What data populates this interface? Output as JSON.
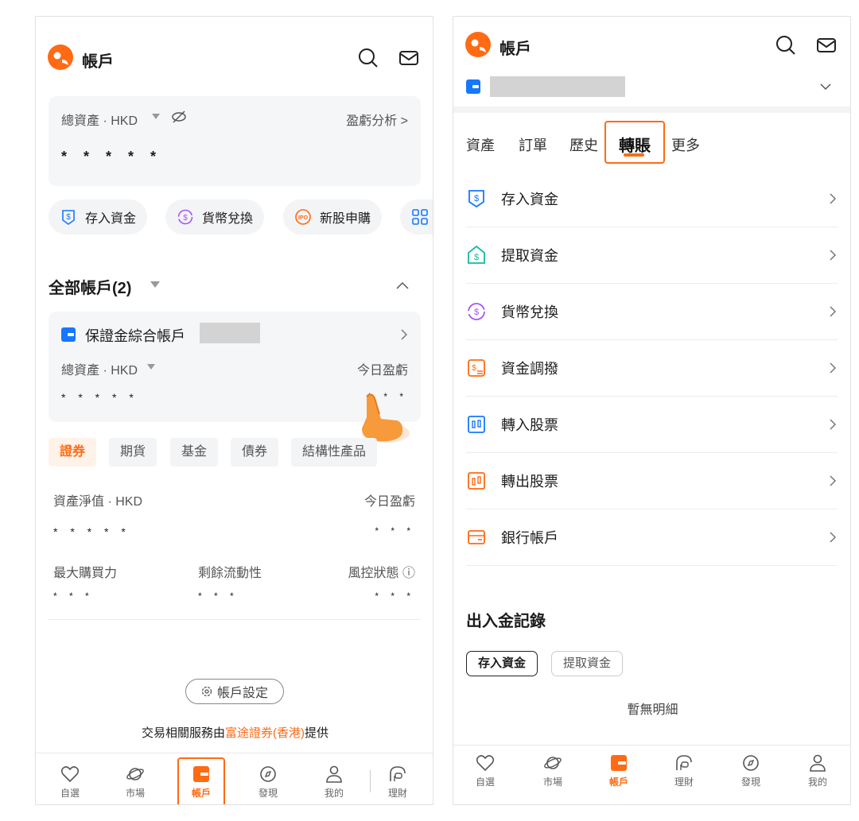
{
  "colors": {
    "accent": "#ff6a13",
    "blue": "#1677ff",
    "teal": "#14b8a6"
  },
  "left": {
    "header": {
      "title": "帳戶"
    },
    "asset_card": {
      "label": "總資產 · HKD",
      "analysis_link": "盈虧分析 >",
      "masked_value": "* * * * *"
    },
    "quick_actions": [
      {
        "label": "存入資金",
        "icon": "deposit-icon"
      },
      {
        "label": "貨幣兌換",
        "icon": "exchange-icon"
      },
      {
        "label": "新股申購",
        "icon": "ipo-icon"
      }
    ],
    "accounts_section": {
      "title": "全部帳戶(2)"
    },
    "account_card": {
      "name": "保證金綜合帳戶",
      "asset_label": "總資產 · HKD",
      "pl_label": "今日盈虧",
      "masked_value": "* * * * *",
      "masked_pl": "* * *"
    },
    "product_tabs": [
      "證券",
      "期貨",
      "基金",
      "債券",
      "結構性產品"
    ],
    "details": {
      "net_label": "資產淨值 · HKD",
      "pl_label": "今日盈虧",
      "masked_net": "* * * * *",
      "masked_pl": "* * *",
      "buying_power": "最大購買力",
      "liquidity": "剩餘流動性",
      "risk_status": "風控狀態 ⓘ",
      "masked_small": "* * *"
    },
    "settings_button": "帳戶設定",
    "footer": {
      "prefix": "交易相關服務由",
      "provider": "富途證券(香港)",
      "suffix": "提供"
    },
    "nav": [
      "自選",
      "市場",
      "帳戶",
      "發現",
      "我的",
      "理財"
    ]
  },
  "right": {
    "header": {
      "title": "帳戶"
    },
    "tabs": [
      "資產",
      "訂單",
      "歷史",
      "轉賬",
      "更多"
    ],
    "rows": [
      "存入資金",
      "提取資金",
      "貨幣兌換",
      "資金調撥",
      "轉入股票",
      "轉出股票",
      "銀行帳戶"
    ],
    "records": {
      "title": "出入金記錄",
      "chips": [
        "存入資金",
        "提取資金"
      ],
      "empty": "暫無明細"
    },
    "nav": [
      "自選",
      "市場",
      "帳戶",
      "理財",
      "發現",
      "我的"
    ]
  }
}
